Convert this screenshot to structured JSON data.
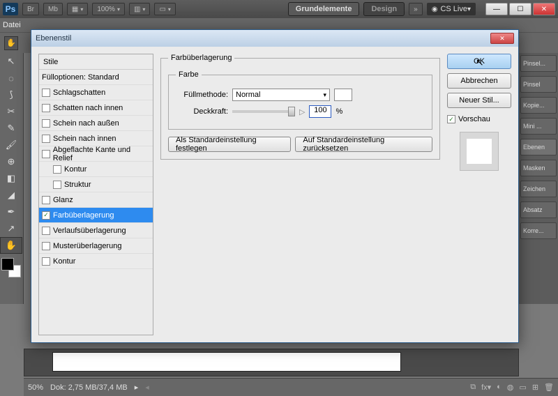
{
  "titlebar": {
    "logo": "Ps",
    "br": "Br",
    "mb": "Mb",
    "zoom": "100%",
    "grundelemente": "Grundelemente",
    "design": "Design",
    "more": "»",
    "cslive": "CS Live"
  },
  "menubar": {
    "datei": "Datei"
  },
  "panels": {
    "items": [
      "Pinsel...",
      "Pinsel",
      "Kopie...",
      "Mini ...",
      "Ebenen",
      "Masken",
      "Zeichen",
      "Absatz",
      "Korre..."
    ],
    "activeIndex": 4
  },
  "statusbar": {
    "zoom": "50%",
    "doksize": "Dok: 2,75 MB/37,4 MB"
  },
  "dialog": {
    "title": "Ebenenstil",
    "stylesHeader": "Stile",
    "fullOptions": "Fülloptionen: Standard",
    "rows": [
      {
        "label": "Schlagschatten",
        "checked": false,
        "indent": false
      },
      {
        "label": "Schatten nach innen",
        "checked": false,
        "indent": false
      },
      {
        "label": "Schein nach außen",
        "checked": false,
        "indent": false
      },
      {
        "label": "Schein nach innen",
        "checked": false,
        "indent": false
      },
      {
        "label": "Abgeflachte Kante und Relief",
        "checked": false,
        "indent": false
      },
      {
        "label": "Kontur",
        "checked": false,
        "indent": true
      },
      {
        "label": "Struktur",
        "checked": false,
        "indent": true
      },
      {
        "label": "Glanz",
        "checked": false,
        "indent": false
      },
      {
        "label": "Farbüberlagerung",
        "checked": true,
        "indent": false,
        "selected": true
      },
      {
        "label": "Verlaufsüberlagerung",
        "checked": false,
        "indent": false
      },
      {
        "label": "Musterüberlagerung",
        "checked": false,
        "indent": false
      },
      {
        "label": "Kontur",
        "checked": false,
        "indent": false
      }
    ],
    "groupTitle": "Farbüberlagerung",
    "farbeLegend": "Farbe",
    "fullMethodLabel": "Füllmethode:",
    "fullMethodValue": "Normal",
    "deckkraftLabel": "Deckkraft:",
    "deckkraftValue": "100",
    "percent": "%",
    "setDefault": "Als Standardeinstellung festlegen",
    "resetDefault": "Auf Standardeinstellung zurücksetzen",
    "ok": "OK",
    "cancel": "Abbrechen",
    "newStyle": "Neuer Stil...",
    "preview": "Vorschau"
  }
}
